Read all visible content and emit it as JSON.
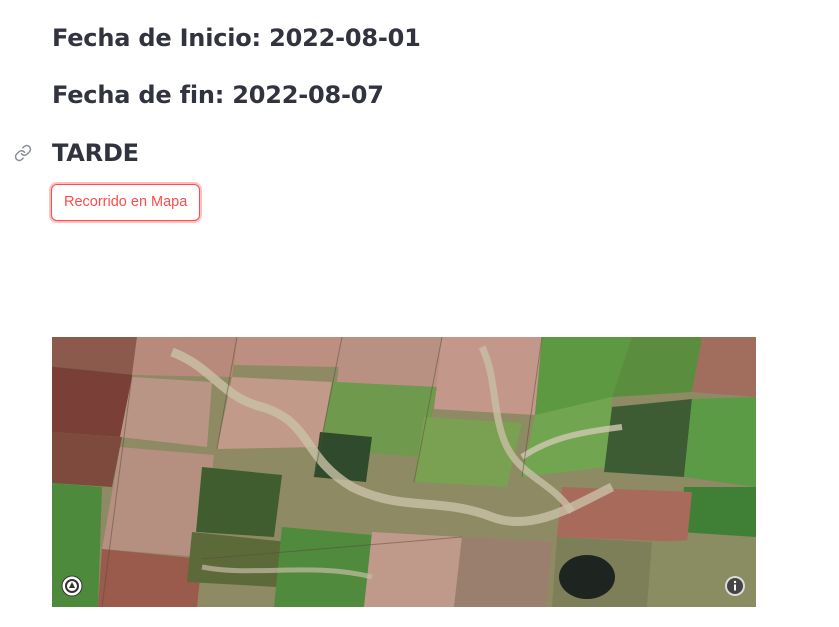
{
  "filters": {
    "start_date": "Fecha de Inicio: 2022-08-01",
    "end_date": "Fecha de fin: 2022-08-07"
  },
  "period": {
    "title": "TARDE",
    "anchor_icon": "link-icon"
  },
  "actions": {
    "map_route_button": "Recorrido en Mapa"
  },
  "map": {
    "type": "satellite imagery of agricultural fields",
    "logo_icon": "map-logo-icon",
    "info_icon": "info-icon"
  },
  "colors": {
    "text": "#31333f",
    "accent": "#ff4b4b"
  }
}
